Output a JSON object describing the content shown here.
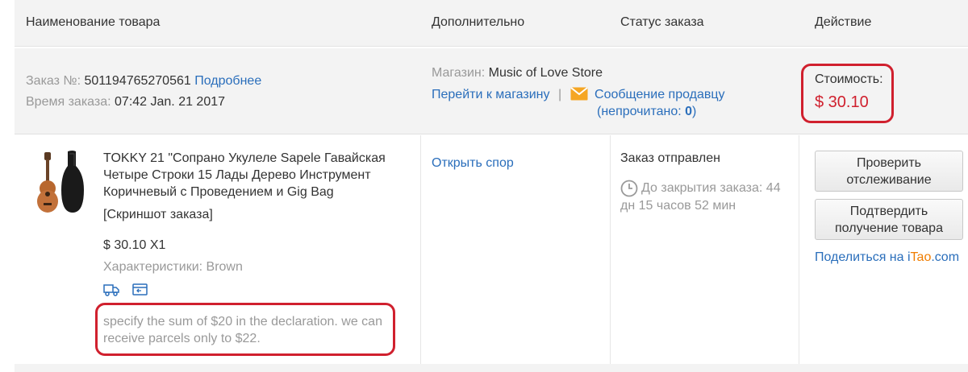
{
  "header": {
    "col_product": "Наименование товара",
    "col_extra": "Дополнительно",
    "col_status": "Статус заказа",
    "col_action": "Действие"
  },
  "order": {
    "number_label": "Заказ №:",
    "number": "501194765270561",
    "details_link": "Подробнее",
    "time_label": "Время заказа:",
    "time": "07:42 Jan. 21 2017",
    "store_label": "Магазин:",
    "store_name": "Music of Love Store",
    "go_to_store": "Перейти к магазину",
    "separator": "|",
    "message_seller": "Сообщение продавцу",
    "unread_open": "(непрочитано: ",
    "unread_count": "0",
    "unread_close": ")",
    "cost_label": "Стоимость:",
    "cost_value": "$ 30.10"
  },
  "item": {
    "title": "TOKKY 21 \"Сопрано Укулеле Sapele Гавайская Четыре Строки 15 Лады Дерево Инструмент Коричневый с Проведением и Gig Bag",
    "screenshot_link": "[Скриншот заказа]",
    "price_qty": "$ 30.10 X1",
    "specs": "Характеристики: Brown",
    "buyer_note": "specify the sum of $20 in the declaration. we can receive parcels only to $22.",
    "open_dispute": "Открыть спор",
    "status": "Заказ отправлен",
    "countdown": "До закрытия заказа: 44 дн 15 часов 52 мин",
    "btn_track": "Проверить отслеживание",
    "btn_confirm": "Подтвердить получение товара",
    "share_prefix": "Поделиться на ",
    "share_i": "i",
    "share_tao": "Tao",
    "share_com": ".com"
  },
  "colors": {
    "link": "#2a6ebb",
    "price": "#d0202e",
    "highlight": "#d0202e",
    "itao_orange": "#f07d00"
  },
  "icons": [
    "mail-icon",
    "clock-icon",
    "shipping-truck-icon",
    "payment-card-icon"
  ]
}
